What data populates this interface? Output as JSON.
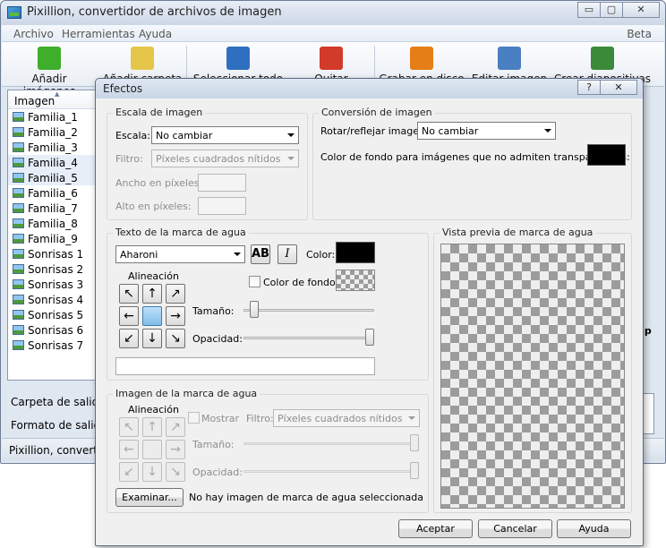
{
  "main_window": {
    "title": "Pixillion, convertidor de archivos de imagen",
    "controls": {
      "minimize": "▭",
      "maximize": "▢",
      "close": "✕"
    },
    "menu": {
      "items": [
        "Archivo",
        "Herramientas",
        "Ayuda"
      ],
      "edition": "Beta"
    },
    "toolbar": [
      {
        "label": "Añadir imágenes",
        "icon": "add-images-icon",
        "color": "#3fae2a"
      },
      {
        "label": "Añadir carpeta",
        "icon": "add-folder-icon",
        "color": "#e6c64a"
      },
      {
        "label": "Seleccionar todo",
        "icon": "select-all-icon",
        "color": "#2f6fbf"
      },
      {
        "label": "Quitar",
        "icon": "remove-icon",
        "color": "#d23a2a"
      },
      {
        "label": "Grabar en disco",
        "icon": "burn-disc-icon",
        "color": "#e67e17"
      },
      {
        "label": "Editar imagen",
        "icon": "edit-image-icon",
        "color": "#4a7fc1"
      },
      {
        "label": "Crear diapositivas",
        "icon": "create-slideshow-icon",
        "color": "#3b8a3a"
      }
    ],
    "file_list": {
      "header": "Imagen",
      "items": [
        "Familia_1",
        "Familia_2",
        "Familia_3",
        "Familia_4",
        "Familia_5",
        "Familia_6",
        "Familia_7",
        "Familia_8",
        "Familia_9",
        "Sonrisas 1",
        "Sonrisas 2",
        "Sonrisas 3",
        "Sonrisas 4",
        "Sonrisas 5",
        "Sonrisas 6",
        "Sonrisas 7"
      ]
    },
    "output_folder_label": "Carpeta de salida:",
    "output_format_label": "Formato de salida:",
    "status": "Pixillion, convertid",
    "behind_fragment": "up",
    "behind_fragment2": "r"
  },
  "dialog": {
    "title": "Efectos",
    "controls": {
      "help": "?",
      "close": "✕"
    },
    "image_scale": {
      "legend": "Escala de imagen",
      "scale_label": "Escala:",
      "scale_value": "No cambiar",
      "filter_label": "Filtro:",
      "filter_value": "Píxeles cuadrados nítidos",
      "width_label": "Ancho en píxeles:",
      "height_label": "Alto en píxeles:"
    },
    "image_conversion": {
      "legend": "Conversión de imagen",
      "rotate_label": "Rotar/reflejar imagen:",
      "rotate_value": "No cambiar",
      "bg_color_label": "Color de fondo para imágenes que no admiten transparencias:",
      "bg_color": "#000000"
    },
    "watermark_text": {
      "legend": "Texto de la marca de agua",
      "font_value": "Aharoni",
      "bold_label": "AB",
      "italic_label": "I",
      "color_label": "Color:",
      "color": "#000000",
      "alignment_label": "Alineación",
      "bg_color_label": "Color de fondo:",
      "size_label": "Tamaño:",
      "opacity_label": "Opacidad:",
      "size_value": 0.05,
      "opacity_value": 1.0,
      "text_value": ""
    },
    "alignment_arrows": [
      "↖",
      "↑",
      "↗",
      "←",
      "",
      "→",
      "↙",
      "↓",
      "↘"
    ],
    "preview": {
      "legend": "Vista previa de marca de agua"
    },
    "watermark_image": {
      "legend": "Imagen de la marca de agua",
      "alignment_label": "Alineación",
      "show_label": "Mostrar",
      "filter_label": "Filtro:",
      "filter_value": "Píxeles cuadrados nítidos",
      "size_label": "Tamaño:",
      "opacity_label": "Opacidad:",
      "size_value": 1.0,
      "opacity_value": 1.0,
      "browse_label": "Examinar...",
      "no_image_text": "No hay imagen de marca de agua seleccionada"
    },
    "buttons": {
      "ok": "Aceptar",
      "cancel": "Cancelar",
      "help": "Ayuda"
    }
  }
}
